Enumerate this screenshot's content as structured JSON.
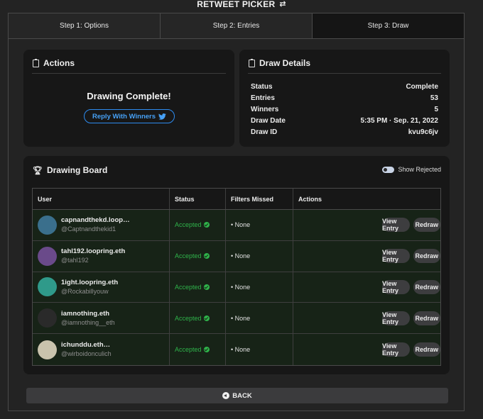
{
  "app": {
    "title": "RETWEET PICKER",
    "title_icon": "retweet-icon"
  },
  "tabs": [
    {
      "label": "Step 1: Options",
      "active": false
    },
    {
      "label": "Step 2: Entries",
      "active": false
    },
    {
      "label": "Step 3: Draw",
      "active": true
    }
  ],
  "actions": {
    "heading": "Actions",
    "heading_icon": "clipboard-check-icon",
    "message": "Drawing Complete!",
    "reply_button": "Reply With Winners",
    "reply_icon": "twitter-bird-icon"
  },
  "details": {
    "heading": "Draw Details",
    "heading_icon": "clipboard-list-icon",
    "rows": [
      {
        "label": "Status",
        "value": "Complete"
      },
      {
        "label": "Entries",
        "value": "53"
      },
      {
        "label": "Winners",
        "value": "5"
      },
      {
        "label": "Draw Date",
        "value": "5:35 PM · Sep. 21, 2022"
      },
      {
        "label": "Draw ID",
        "value": "kvu9c6jv"
      }
    ]
  },
  "board": {
    "heading": "Drawing Board",
    "heading_icon": "trophy-icon",
    "toggle_label": "Show Rejected",
    "columns": [
      "User",
      "Status",
      "Filters Missed",
      "Actions"
    ],
    "view_label": "View Entry",
    "redraw_label": "Redraw",
    "rows": [
      {
        "name": "capnandthekd.loop…",
        "handle": "@Captnandthekid1",
        "status": "Accepted",
        "filters": "• None",
        "avatar_color": "#3a6f8c"
      },
      {
        "name": "tahl192.loopring.eth",
        "handle": "@tahl192",
        "status": "Accepted",
        "filters": "• None",
        "avatar_color": "#6a4a8a"
      },
      {
        "name": "1ight.loopring.eth",
        "handle": "@Rockabillyouw",
        "status": "Accepted",
        "filters": "• None",
        "avatar_color": "#2f9a8a"
      },
      {
        "name": "iamnothing.eth",
        "handle": "@iamnothing__eth",
        "status": "Accepted",
        "filters": "• None",
        "avatar_color": "#2a2a2a"
      },
      {
        "name": "ichunddu.eth…",
        "handle": "@wirboidonculich",
        "status": "Accepted",
        "filters": "• None",
        "avatar_color": "#c9c3ad"
      }
    ]
  },
  "back_button": "BACK",
  "colors": {
    "accent_blue": "#2d8cf0",
    "accepted_green": "#2fb34a",
    "row_bg": "#172317"
  }
}
